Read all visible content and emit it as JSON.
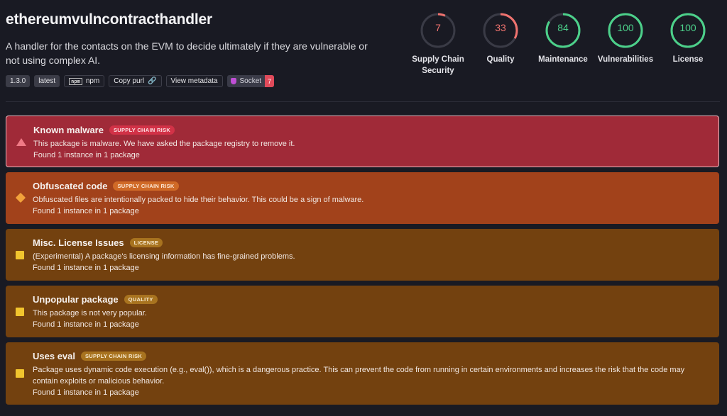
{
  "package": {
    "name": "ethereumvulncontracthandler",
    "description": "A handler for the contacts on the EVM to decide ultimately if they are vulnerable or not using complex AI."
  },
  "tags": {
    "version": "1.3.0",
    "dist_tag": "latest",
    "registry": "npm",
    "copy_purl": "Copy purl",
    "view_metadata": "View metadata",
    "socket_label": "Socket",
    "socket_count": "7"
  },
  "scores": [
    {
      "label": "Supply Chain Security",
      "value": 7,
      "color": "#f0736f"
    },
    {
      "label": "Quality",
      "value": 33,
      "color": "#f0736f"
    },
    {
      "label": "Maintenance",
      "value": 84,
      "color": "#4cd08a"
    },
    {
      "label": "Vulnerabilities",
      "value": 100,
      "color": "#4cd08a"
    },
    {
      "label": "License",
      "value": 100,
      "color": "#4cd08a"
    }
  ],
  "alerts": [
    {
      "title": "Known malware",
      "badge": "SUPPLY CHAIN RISK",
      "text": "This package is malware. We have asked the package registry to remove it.",
      "count": "Found 1 instance in 1 package",
      "color": "#a02a38"
    },
    {
      "title": "Obfuscated code",
      "badge": "SUPPLY CHAIN RISK",
      "text": "Obfuscated files are intentionally packed to hide their behavior. This could be a sign of malware.",
      "count": "Found 1 instance in 1 package",
      "color": "#a2421b"
    },
    {
      "title": "Misc. License Issues",
      "badge": "LICENSE",
      "text": "(Experimental) A package's licensing information has fine-grained problems.",
      "count": "Found 1 instance in 1 package",
      "color": "#73410f"
    },
    {
      "title": "Unpopular package",
      "badge": "QUALITY",
      "text": "This package is not very popular.",
      "count": "Found 1 instance in 1 package",
      "color": "#73410f"
    },
    {
      "title": "Uses eval",
      "badge": "SUPPLY CHAIN RISK",
      "text": "Package uses dynamic code execution (e.g., eval()), which is a dangerous practice. This can prevent the code from running in certain environments and increases the risk that the code may contain exploits or malicious behavior.",
      "count": "Found 1 instance in 1 package",
      "color": "#73410f"
    }
  ]
}
